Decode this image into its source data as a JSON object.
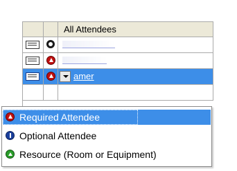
{
  "grid": {
    "header": {
      "all_attendees": "All Attendees"
    },
    "rows": [
      {
        "name": "",
        "type_icon": "status-ring-icon"
      },
      {
        "name": "",
        "type_icon": "required-attendee-icon"
      },
      {
        "name": "amer",
        "type_icon": "required-attendee-icon",
        "selected": true
      }
    ]
  },
  "attendee_type_menu": {
    "items": [
      {
        "label": "Required Attendee",
        "icon": "required-attendee-icon",
        "highlighted": true
      },
      {
        "label": "Optional Attendee",
        "icon": "optional-attendee-icon"
      },
      {
        "label": "Resource (Room or Equipment)",
        "icon": "resource-icon"
      }
    ]
  },
  "colors": {
    "selection": "#3d8ee8",
    "header_bg": "#ece9d8",
    "required": "#c01010",
    "optional": "#1b3f9c",
    "resource": "#2a9d2a"
  }
}
